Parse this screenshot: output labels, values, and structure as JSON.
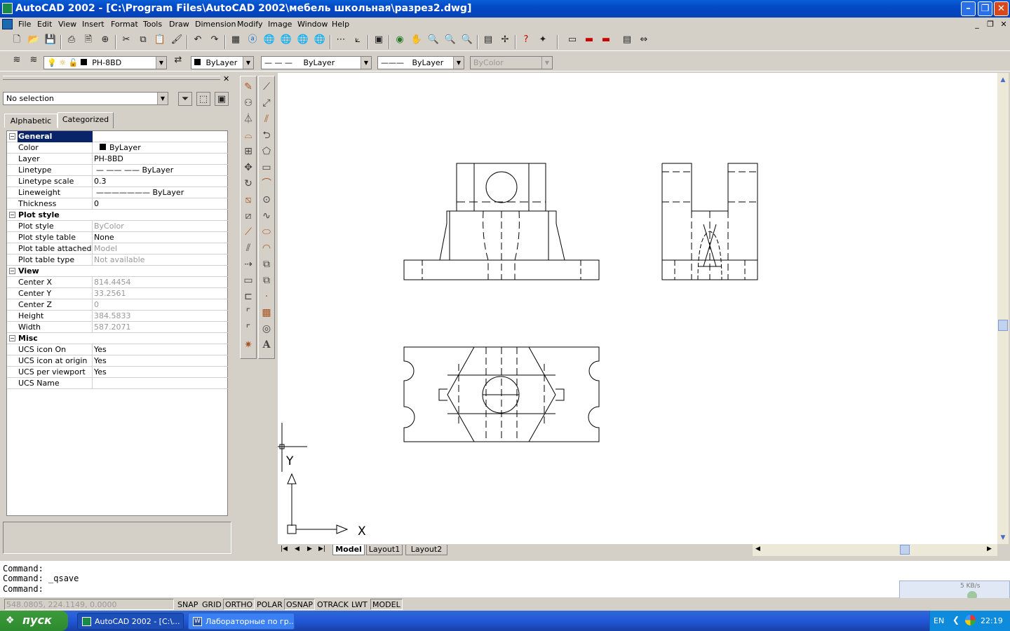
{
  "window": {
    "title": "AutoCAD 2002 - [C:\\Program Files\\AutoCAD 2002\\мебель школьная\\разрез2.dwg]"
  },
  "menu": [
    "File",
    "Edit",
    "View",
    "Insert",
    "Format",
    "Tools",
    "Draw",
    "Dimension",
    "Modify",
    "Image",
    "Window",
    "Help"
  ],
  "layers_toolbar": {
    "layer_name": "PH-8BD",
    "color": "ByLayer",
    "linetype": "ByLayer",
    "lineweight": "ByLayer",
    "plotstyle": "ByColor"
  },
  "properties": {
    "selection": "No selection",
    "tabs": [
      "Alphabetic",
      "Categorized"
    ],
    "active_tab": "Categorized",
    "categories": [
      {
        "name": "General",
        "rows": [
          {
            "k": "Color",
            "v": "ByLayer"
          },
          {
            "k": "Layer",
            "v": "PH-8BD"
          },
          {
            "k": "Linetype",
            "v": "ByLayer"
          },
          {
            "k": "Linetype scale",
            "v": "0.3"
          },
          {
            "k": "Lineweight",
            "v": "ByLayer"
          },
          {
            "k": "Thickness",
            "v": "0"
          }
        ]
      },
      {
        "name": "Plot style",
        "rows": [
          {
            "k": "Plot style",
            "v": "ByColor"
          },
          {
            "k": "Plot style table",
            "v": "None"
          },
          {
            "k": "Plot table attached to",
            "v": "Model"
          },
          {
            "k": "Plot table type",
            "v": "Not available"
          }
        ]
      },
      {
        "name": "View",
        "rows": [
          {
            "k": "Center X",
            "v": "814.4454"
          },
          {
            "k": "Center Y",
            "v": "33.2561"
          },
          {
            "k": "Center Z",
            "v": "0"
          },
          {
            "k": "Height",
            "v": "384.5833"
          },
          {
            "k": "Width",
            "v": "587.2071"
          }
        ]
      },
      {
        "name": "Misc",
        "rows": [
          {
            "k": "UCS icon On",
            "v": "Yes"
          },
          {
            "k": "UCS icon at origin",
            "v": "Yes"
          },
          {
            "k": "UCS per viewport",
            "v": "Yes"
          },
          {
            "k": "UCS Name",
            "v": ""
          }
        ]
      }
    ]
  },
  "layout_tabs": [
    "Model",
    "Layout1",
    "Layout2"
  ],
  "ucs": {
    "x_label": "X",
    "y_label": "Y"
  },
  "command_lines": [
    "Command:",
    "Command: _qsave",
    "Command:"
  ],
  "status": {
    "coords": "548.0805, 224.1149, 0.0000",
    "toggles": [
      "SNAP",
      "GRID",
      "ORTHO",
      "POLAR",
      "OSNAP",
      "OTRACK",
      "LWT",
      "MODEL"
    ]
  },
  "netmeter": "5 KB/s",
  "taskbar": {
    "start_label": "пуск",
    "tasks": [
      "AutoCAD 2002 - [C:\\...",
      "Лабораторные по гр..."
    ],
    "lang": "EN",
    "clock": "22:19"
  }
}
